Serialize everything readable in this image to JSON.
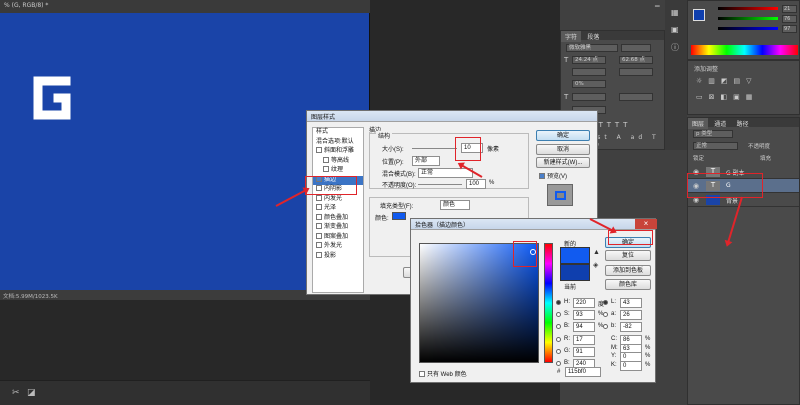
{
  "document": {
    "tab_title": "% (G, RGB/8) *",
    "glyph": "G",
    "status": "文档:5.99M/1023.5K"
  },
  "layer_style_dialog": {
    "title": "图层样式",
    "styles_header": "样式",
    "blend_default": "混合选项:默认",
    "items": [
      {
        "label": "斜面和浮雕",
        "checked": false,
        "selected": false
      },
      {
        "label": "等高线",
        "checked": false,
        "selected": false
      },
      {
        "label": "纹理",
        "checked": false,
        "selected": false
      },
      {
        "label": "描边",
        "checked": true,
        "selected": true
      },
      {
        "label": "内阴影",
        "checked": false,
        "selected": false
      },
      {
        "label": "内发光",
        "checked": false,
        "selected": false
      },
      {
        "label": "光泽",
        "checked": false,
        "selected": false
      },
      {
        "label": "颜色叠加",
        "checked": false,
        "selected": false
      },
      {
        "label": "渐变叠加",
        "checked": false,
        "selected": false
      },
      {
        "label": "图案叠加",
        "checked": false,
        "selected": false
      },
      {
        "label": "外发光",
        "checked": false,
        "selected": false
      },
      {
        "label": "投影",
        "checked": false,
        "selected": false
      }
    ],
    "stroke_header": "描边",
    "structure": "结构",
    "size_label": "大小(S):",
    "size_value": "10",
    "size_unit": "像素",
    "position_label": "位置(P):",
    "position_value": "外部",
    "blend_label": "混合模式(B):",
    "blend_value": "正常",
    "opacity_label": "不透明度(O):",
    "opacity_value": "100",
    "opacity_unit": "%",
    "fill_type_label": "填充类型(F):",
    "fill_type_value": "颜色",
    "color_label": "颜色:",
    "ok": "确定",
    "cancel": "取消",
    "new_style": "新建样式(W)...",
    "preview": "预览(V)",
    "set_default": "设"
  },
  "color_picker": {
    "title": "拾色器（描边颜色）",
    "new_label": "新的",
    "current_label": "当前",
    "ok": "确定",
    "reset": "复位",
    "add_swatches": "添加到色板",
    "color_libraries": "颜色库",
    "web_only": "只有 Web 颜色",
    "fields": [
      {
        "label": "H:",
        "value": "220",
        "unit": "度"
      },
      {
        "label": "S:",
        "value": "93",
        "unit": "%"
      },
      {
        "label": "B:",
        "value": "94",
        "unit": "%"
      },
      {
        "label": "R:",
        "value": "17",
        "unit": ""
      },
      {
        "label": "G:",
        "value": "91",
        "unit": ""
      },
      {
        "label": "B:",
        "value": "240",
        "unit": ""
      }
    ],
    "lab_fields": [
      {
        "label": "L:",
        "value": "43"
      },
      {
        "label": "a:",
        "value": "26"
      },
      {
        "label": "b:",
        "value": "-82"
      }
    ],
    "cmyk_fields": [
      {
        "label": "C:",
        "value": "86",
        "unit": "%"
      },
      {
        "label": "M:",
        "value": "63",
        "unit": "%"
      },
      {
        "label": "Y:",
        "value": "0",
        "unit": "%"
      },
      {
        "label": "K:",
        "value": "0",
        "unit": "%"
      }
    ],
    "hex_label": "#",
    "hex_value": "115bf0",
    "colors": {
      "new": "#115bf0",
      "current": "#0f3fae",
      "stroke_swatch": "#115bf0"
    }
  },
  "panels": {
    "character_tabs": [
      "字符",
      "段落"
    ],
    "font_family": "微软雅黑",
    "font_size": "24.24 点",
    "leading": "62.68 点",
    "tracking": "0%",
    "color_values": [
      "21",
      "76",
      "97"
    ],
    "adjust_label": "添加调整",
    "styles_tab": "样式",
    "layers_tabs": [
      "图层",
      "通道",
      "路径"
    ],
    "kind_label": "p 类型",
    "blend_mode": "正常",
    "opacity": "不透明度",
    "fill": "填充",
    "lock": "锁定",
    "layers": [
      {
        "name": "G 副本",
        "type": "T",
        "selected": false
      },
      {
        "name": "G",
        "type": "T",
        "selected": true
      },
      {
        "name": "背景",
        "type": "bg",
        "selected": false
      }
    ]
  }
}
